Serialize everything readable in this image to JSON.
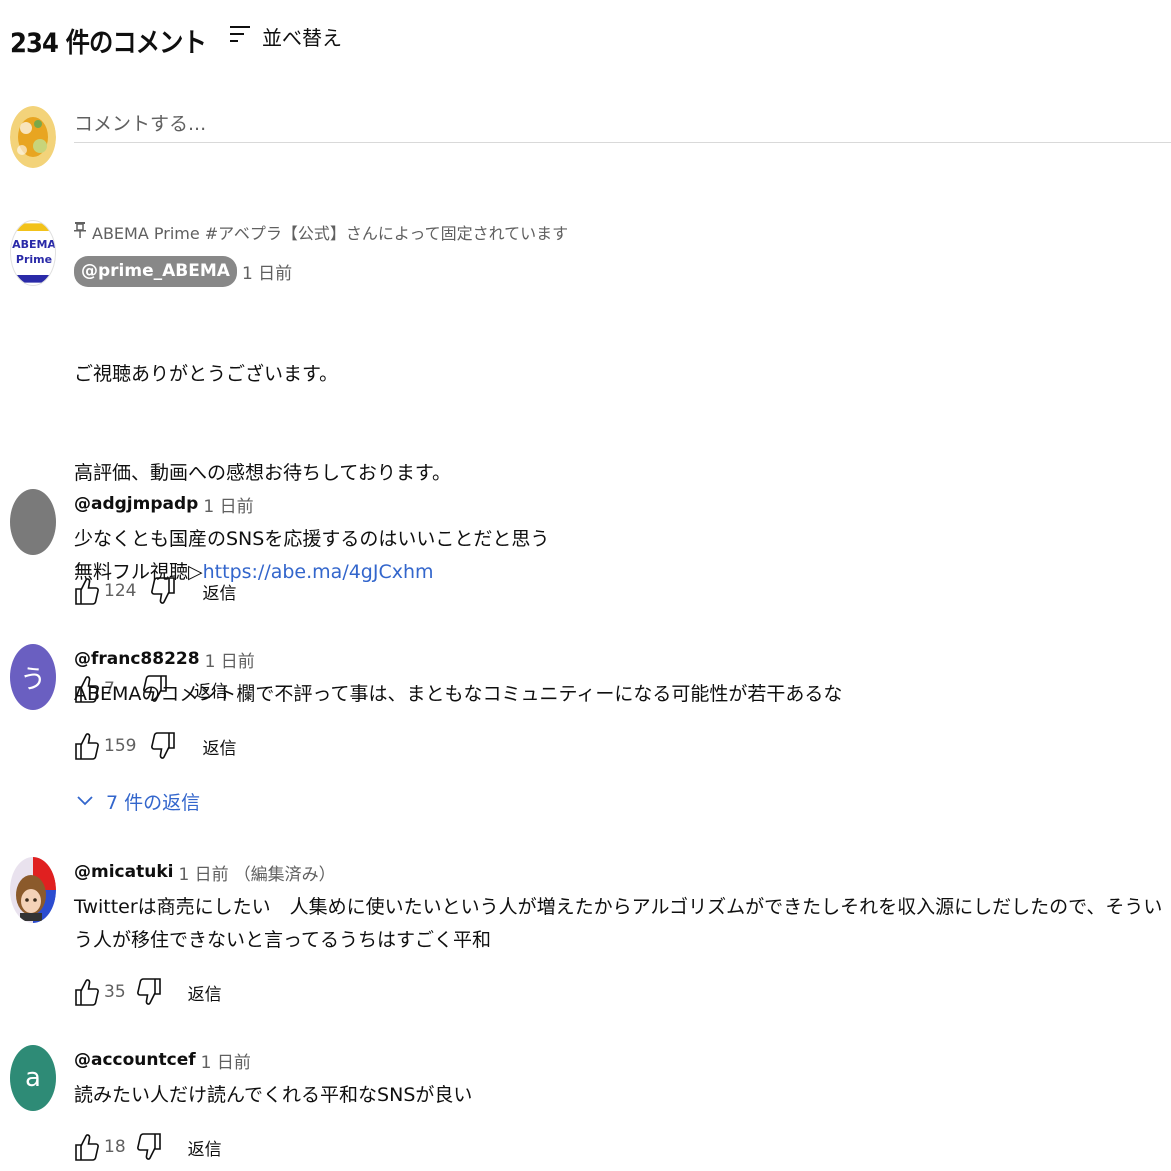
{
  "header": {
    "count_label": "234 件のコメント",
    "sort_label": "並べ替え",
    "sort_icon": "sort-icon"
  },
  "compose": {
    "placeholder": "コメントする..."
  },
  "comments": [
    {
      "pinned_text": "ABEMA Prime #アベプラ【公式】さんによって固定されています",
      "author": "@prime_ABEMA",
      "time": "1 日前",
      "lines": [
        "ご視聴ありがとうございます。",
        "高評価、動画への感想お待ちしております。"
      ],
      "link_prefix": "無料フル視聴▷",
      "link_text": "https://abe.ma/4gJCxhm",
      "likes": "7",
      "reply_label": "返信",
      "avatar_text": [
        "ABEMA",
        "Prime"
      ]
    },
    {
      "author": "@adgjmpadp",
      "time": "1 日前",
      "text": "少なくとも国産のSNSを応援するのはいいことだと思う",
      "likes": "124",
      "reply_label": "返信"
    },
    {
      "author": "@franc88228",
      "time": "1 日前",
      "text": "ABEMAのコメント欄で不評って事は、まともなコミュニティーになる可能性が若干あるな",
      "likes": "159",
      "reply_label": "返信",
      "avatar_letter": "う",
      "replies_label": "7 件の返信"
    },
    {
      "author": "@micatuki",
      "time": "1 日前",
      "edited": "（編集済み）",
      "text": "Twitterは商売にしたい　人集めに使いたいという人が増えたからアルゴリズムができたしそれを収入源にしだしたので、そういう人が移住できないと言ってるうちはすごく平和",
      "likes": "35",
      "reply_label": "返信"
    },
    {
      "author": "@accountcef",
      "time": "1 日前",
      "text": "読みたい人だけ読んでくれる平和なSNSが良い",
      "likes": "18",
      "reply_label": "返信",
      "avatar_letter": "a"
    }
  ],
  "colors": {
    "link": "#3366cc",
    "secondary_text": "#606060",
    "avatar_franc": "#6a5fc1",
    "avatar_account": "#2e8b76",
    "avatar_adgj": "#7a7a7a",
    "abema_blue": "#2a2aa8"
  }
}
